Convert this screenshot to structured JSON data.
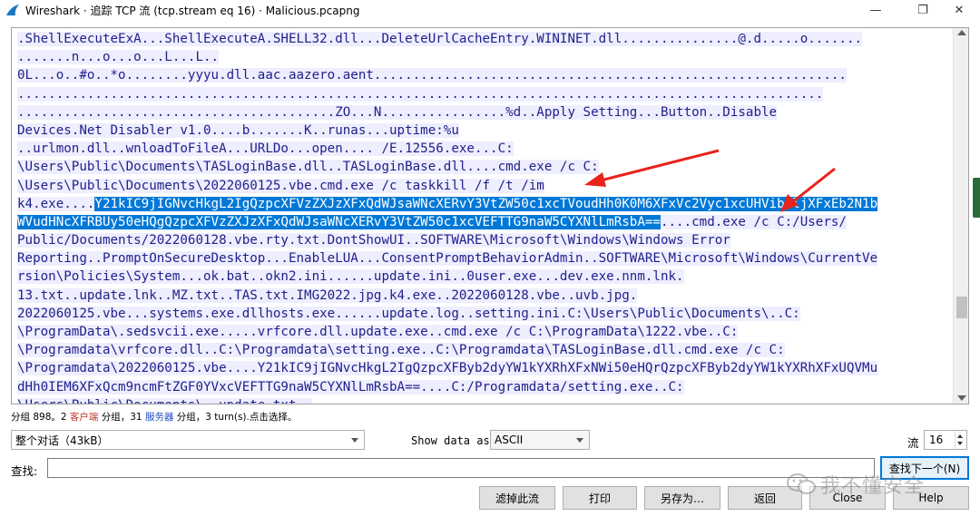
{
  "window": {
    "title": "Wireshark · 追踪 TCP 流 (tcp.stream eq 16) · Malicious.pcapng",
    "minimize": "—",
    "maximize": "❐",
    "close": "✕"
  },
  "stream": {
    "lines": [
      {
        "seg": [
          {
            "t": ".ShellExecuteExA...ShellExecuteA.SHELL32.dll...DeleteUrlCacheEntry.WININET.dll...............@.d.....o.......",
            "c": "srv"
          }
        ]
      },
      {
        "seg": [
          {
            "t": ".......n...o...o...L...L..",
            "c": "srv"
          }
        ]
      },
      {
        "seg": [
          {
            "t": "0L...o..#o..*o........yyyu.dll.aac.aazero.aent.............................................................",
            "c": "srv"
          }
        ]
      },
      {
        "seg": [
          {
            "t": "........................................................................................................",
            "c": "srv"
          }
        ]
      },
      {
        "seg": [
          {
            "t": ".........................................ZO...N................%d..Apply Setting...Button..Disable",
            "c": "srv"
          }
        ]
      },
      {
        "seg": [
          {
            "t": "Devices.Net Disabler v1.0....b.......K..runas...uptime:%u",
            "c": "srv"
          }
        ]
      },
      {
        "seg": [
          {
            "t": "..urlmon.dll..wnloadToFileA...URLDo...open.... /E.12556.exe...C:",
            "c": "srv"
          }
        ]
      },
      {
        "seg": [
          {
            "t": "\\Users\\Public\\Documents\\TASLoginBase.dll..TASLoginBase.dll....cmd.exe /c C:",
            "c": "srv"
          }
        ]
      },
      {
        "seg": [
          {
            "t": "\\Users\\Public\\Documents\\2022060125.vbe.cmd.exe /c taskkill /f /t /im",
            "c": "srv"
          }
        ]
      },
      {
        "seg": [
          {
            "t": "k4.exe....",
            "c": "srv"
          },
          {
            "t": "Y21kIC9jIGNvcHkgL2IgQzpcXFVzZXJzXFxQdWJsaWNcXERvY3VtZW50c1xcTVoudHh0K0M6XFxVc2Vyc1xcUHVibGljXFxEb2N1b",
            "c": "sel"
          }
        ]
      },
      {
        "seg": [
          {
            "t": "WVudHNcXFRBUy50eHQgQzpcXFVzZXJzXFxQdWJsaWNcXERvY3VtZW50c1xcVEFTTG9naW5CYXNlLmRsbA==",
            "c": "sel"
          },
          {
            "t": "....cmd.exe /c C:/Users/",
            "c": "srv"
          }
        ]
      },
      {
        "seg": [
          {
            "t": "Public/Documents/2022060128.vbe.rty.txt.DontShowUI..SOFTWARE\\Microsoft\\Windows\\Windows Error",
            "c": "srv"
          }
        ]
      },
      {
        "seg": [
          {
            "t": "Reporting..PromptOnSecureDesktop...EnableLUA...ConsentPromptBehaviorAdmin..SOFTWARE\\Microsoft\\Windows\\CurrentVe",
            "c": "srv"
          }
        ]
      },
      {
        "seg": [
          {
            "t": "rsion\\Policies\\System...ok.bat..okn2.ini......update.ini..0user.exe...dev.exe.nnm.lnk.",
            "c": "srv"
          }
        ]
      },
      {
        "seg": [
          {
            "t": "13.txt..update.lnk..MZ.txt..TAS.txt.IMG2022.jpg.k4.exe..2022060128.vbe..uvb.jpg.",
            "c": "srv"
          }
        ]
      },
      {
        "seg": [
          {
            "t": "2022060125.vbe...systems.exe.dllhosts.exe......update.log..setting.ini.C:\\Users\\Public\\Documents\\..C:",
            "c": "srv"
          }
        ]
      },
      {
        "seg": [
          {
            "t": "\\ProgramData\\.sedsvcii.exe.....vrfcore.dll.update.exe..cmd.exe /c C:\\ProgramData\\1222.vbe..C:",
            "c": "srv"
          }
        ]
      },
      {
        "seg": [
          {
            "t": "\\Programdata\\vrfcore.dll..C:\\Programdata\\setting.exe..C:\\Programdata\\TASLoginBase.dll.cmd.exe /c C:",
            "c": "srv"
          }
        ]
      },
      {
        "seg": [
          {
            "t": "\\Programdata\\2022060125.vbe....Y21kIC9jIGNvcHkgL2IgQzpcXFByb2dyYW1kYXRhXFxNWi50eHQrQzpcXFByb2dyYW1kYXRhXFxUQVMu",
            "c": "srv"
          }
        ]
      },
      {
        "seg": [
          {
            "t": "dHh0IEM6XFxQcm9ncmFtZGF0YVxcVEFTTG9naW5CYXNlLmRsbA==....C:/Programdata/setting.exe..C:",
            "c": "srv"
          }
        ]
      },
      {
        "seg": [
          {
            "t": "\\Users\\Public\\Documents\\..update.txt..",
            "c": "srv"
          }
        ]
      }
    ]
  },
  "status": {
    "part1": "分组 898。2 ",
    "client": "客户端",
    "part2": " 分组，31 ",
    "server": "服务器",
    "part3": " 分组，3 turn(s).点击选择。"
  },
  "controls": {
    "conversation_select": "整个对话（43kB）",
    "show_data_as_label": "Show data as",
    "show_data_as_value": "ASCII",
    "stream_label": "流",
    "stream_value": "16",
    "find_label": "查找:",
    "find_value": "",
    "find_next": "查找下一个(N)"
  },
  "buttons": {
    "filter_out": "滤掉此流",
    "print": "打印",
    "save_as": "另存为…",
    "back": "返回",
    "close": "Close",
    "help": "Help"
  },
  "watermark": "我不懂安全",
  "colors": {
    "selection": "#0078d7",
    "stream_text": "#1f1f8a",
    "stream_bg": "#eeeeff",
    "arrow": "#e8231c",
    "client": "#c0392b",
    "server": "#1f4fbf"
  }
}
